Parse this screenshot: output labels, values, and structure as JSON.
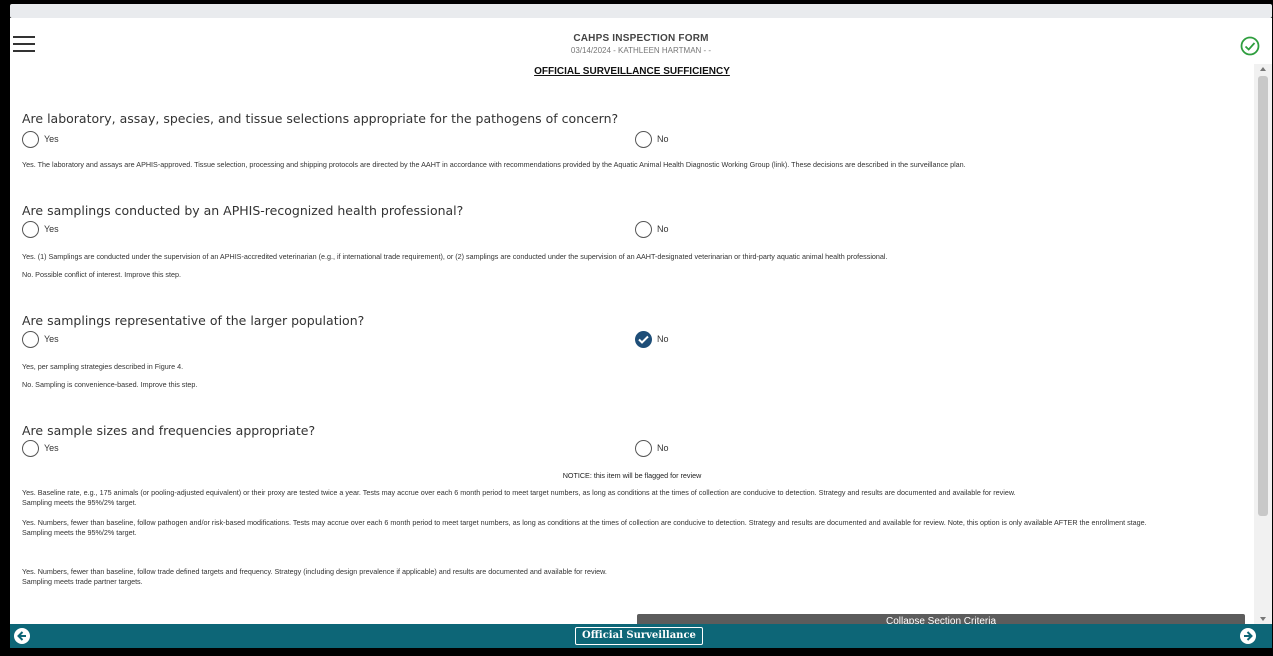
{
  "header": {
    "title": "CAHPS INSPECTION FORM",
    "subtitle": "03/14/2024 - KATHLEEN HARTMAN - -"
  },
  "section_title": "OFFICIAL SURVEILLANCE SUFFICIENCY",
  "questions": [
    {
      "text": "Are laboratory, assay, species, and tissue selections appropriate for the pathogens of concern?",
      "yes_label": "Yes",
      "no_label": "No",
      "selected": "none",
      "options": [
        "Yes. The laboratory and assays are APHIS-approved. Tissue selection, processing and shipping protocols are directed by the AAHT in accordance with recommendations provided by the Aquatic Animal Health Diagnostic Working Group (link). These decisions are described in the surveillance plan."
      ]
    },
    {
      "text": "Are samplings conducted by an APHIS-recognized health professional?",
      "yes_label": "Yes",
      "no_label": "No",
      "selected": "none",
      "options": [
        "Yes. (1) Samplings are conducted under the supervision of an APHIS-accredited veterinarian (e.g., if international trade requirement), or (2) samplings are conducted under the supervision of an AAHT-designated veterinarian or third-party aquatic animal health professional.",
        "No. Possible conflict of interest. Improve this step."
      ]
    },
    {
      "text": "Are samplings representative of the larger population?",
      "yes_label": "Yes",
      "no_label": "No",
      "selected": "no",
      "options": [
        "Yes, per sampling strategies described in Figure 4.",
        "No. Sampling is convenience-based. Improve this step."
      ]
    },
    {
      "text": "Are sample sizes and frequencies appropriate?",
      "yes_label": "Yes",
      "no_label": "No",
      "selected": "none",
      "notice": "NOTICE: this item will be flagged for review",
      "options": [
        {
          "line1": "Yes. Baseline rate, e.g., 175 animals (or pooling-adjusted equivalent) or their proxy are tested twice a year. Tests may accrue over each 6 month period to meet target numbers, as long as conditions at the times of collection are conducive to detection. Strategy and results are documented and available for review.",
          "line2": "Sampling meets the 95%/2% target."
        },
        {
          "line1": "Yes. Numbers, fewer than baseline, follow pathogen and/or risk-based modifications. Tests may accrue over each 6 month period to meet target numbers, as long as conditions at the times of collection are conducive to detection. Strategy and results are documented and available for review. Note, this option is only available AFTER the enrollment stage.",
          "line2": "Sampling meets the 95%/2% target."
        },
        {
          "line1": "Yes. Numbers, fewer than baseline, follow trade defined targets and frequency. Strategy (including design prevalence if applicable) and results are documented and available for review.",
          "line2": "Sampling meets trade partner targets."
        }
      ]
    }
  ],
  "collapse_button_label": "Collapse Section Criteria",
  "footer": {
    "label": "Official Surveillance",
    "color": "#0d6677"
  },
  "colors": {
    "accent": "#1e4e78",
    "check_green": "#2e9e3e"
  },
  "icons": {
    "menu": "hamburger-icon",
    "status": "check-circle-icon",
    "prev": "arrow-left-circle-icon",
    "next": "arrow-right-circle-icon"
  }
}
